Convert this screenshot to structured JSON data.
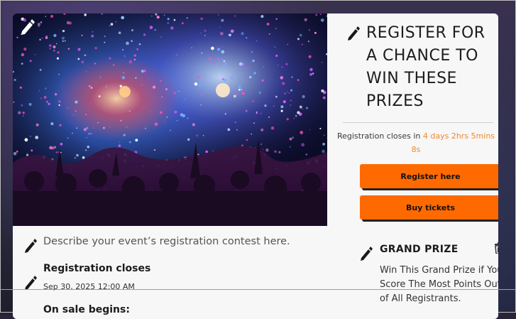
{
  "right_panel": {
    "heading_lines": [
      "REGISTER FOR",
      "A CHANCE TO",
      "WIN THESE",
      "PRIZES"
    ],
    "registration_closes_prefix": "Registration closes in",
    "countdown": "4 days 2hrs 5mins 8s",
    "register_button": "Register here",
    "tickets_button": "Buy tickets",
    "grand_prize": {
      "title": "GRAND PRIZE",
      "description": "Win This Grand Prize if You Score The Most Points Out of All Registrants."
    }
  },
  "details": {
    "description_placeholder": "Describe your event’s registration contest here.",
    "registration_closes_label": "Registration closes",
    "registration_closes_date": "Sep 30, 2025 12:00 AM",
    "on_sale_label": "On sale begins:"
  },
  "colors": {
    "accent": "#ff6a00",
    "countdown": "#f08a2c",
    "card_bg": "#f7f7f7"
  },
  "icons": [
    "pencil-icon",
    "trash-icon"
  ]
}
